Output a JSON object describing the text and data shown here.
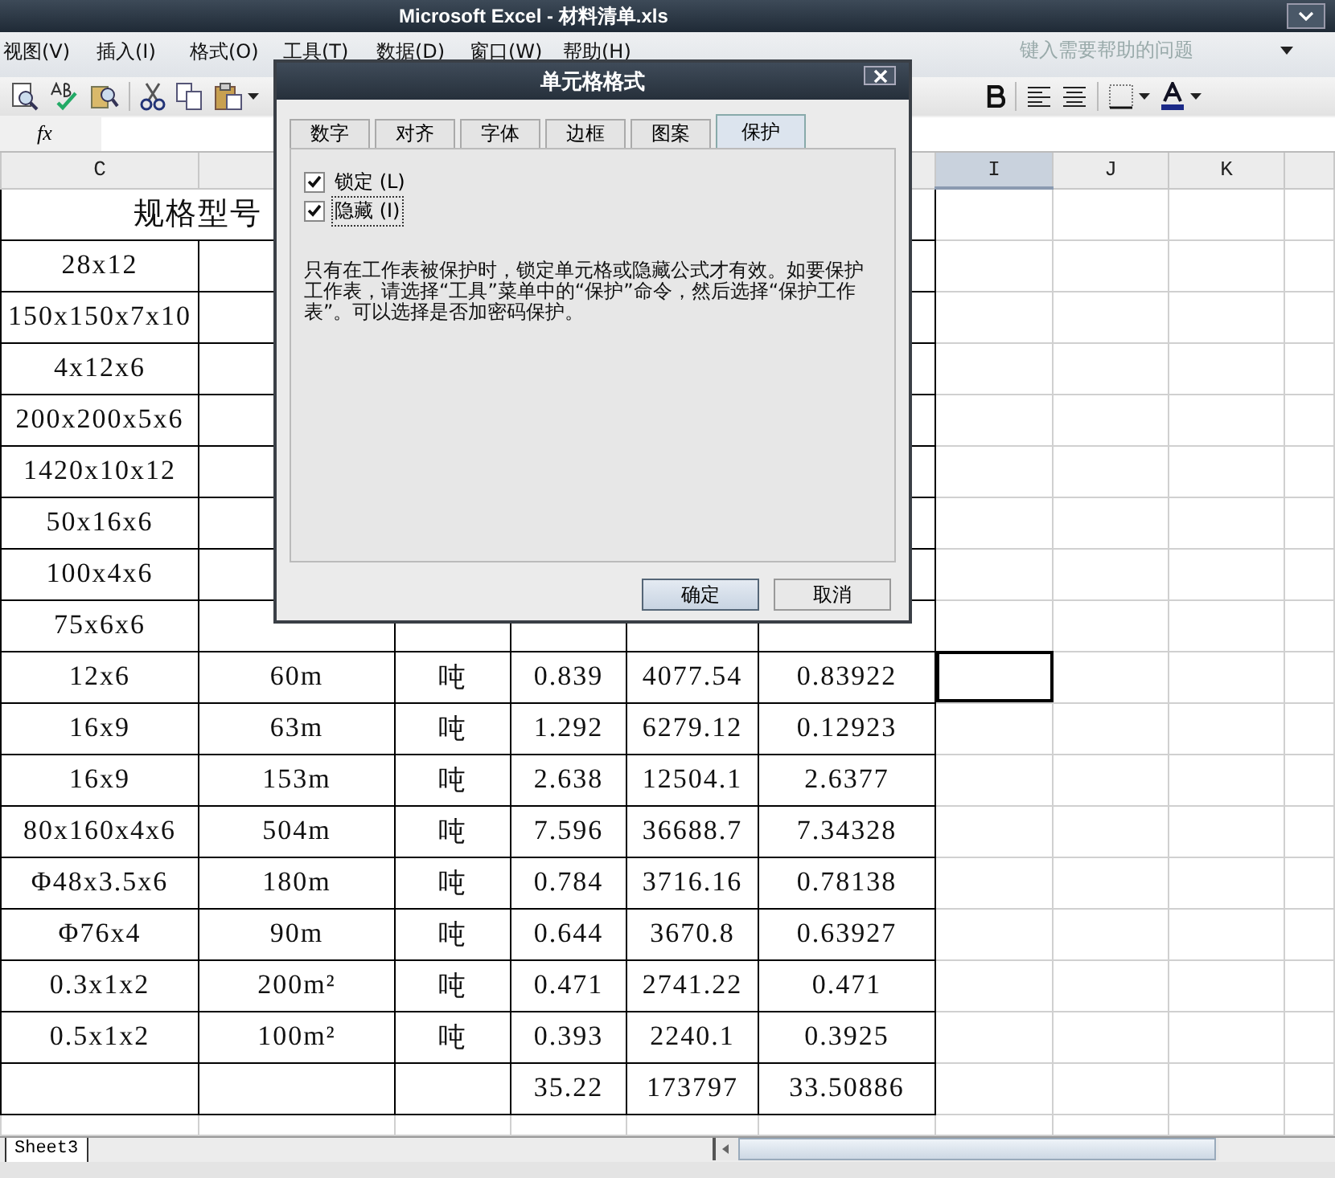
{
  "window": {
    "title": "Microsoft Excel - 材料清单.xls"
  },
  "menu": [
    "视图(V)",
    "插入(I)",
    "格式(O)",
    "工具(T)",
    "数据(D)",
    "窗口(W)",
    "帮助(H)"
  ],
  "help_search": {
    "placeholder": "键入需要帮助的问题"
  },
  "formula_bar": {
    "function_label": "fx"
  },
  "columns": [
    {
      "label": "C",
      "selected": false
    },
    {
      "label": "I",
      "selected": true
    },
    {
      "label": "J",
      "selected": false
    },
    {
      "label": "K",
      "selected": false
    }
  ],
  "header_row": "规格型号",
  "rows": [
    {
      "cells": [
        "28x12"
      ],
      "selected": false
    },
    {
      "cells": [
        "150x150x7x10"
      ],
      "selected": false
    },
    {
      "cells": [
        "4x12x6"
      ],
      "selected": false
    },
    {
      "cells": [
        "200x200x5x6"
      ],
      "selected": false
    },
    {
      "cells": [
        "1420x10x12"
      ],
      "selected": false
    },
    {
      "cells": [
        "50x16x6"
      ],
      "selected": false
    },
    {
      "cells": [
        "100x4x6"
      ],
      "selected": false
    },
    {
      "cells": [
        "75x6x6"
      ],
      "selected": false
    },
    {
      "cells": [
        "12x6",
        "60m",
        "吨",
        "0.839",
        "4077.54",
        "0.83922"
      ],
      "selected": true
    },
    {
      "cells": [
        "16x9",
        "63m",
        "吨",
        "1.292",
        "6279.12",
        "0.12923"
      ],
      "selected": false
    },
    {
      "cells": [
        "16x9",
        "153m",
        "吨",
        "2.638",
        "12504.1",
        "2.6377"
      ],
      "selected": false
    },
    {
      "cells": [
        "80x160x4x6",
        "504m",
        "吨",
        "7.596",
        "36688.7",
        "7.34328"
      ],
      "selected": false
    },
    {
      "cells": [
        "Φ48x3.5x6",
        "180m",
        "吨",
        "0.784",
        "3716.16",
        "0.78138"
      ],
      "selected": false
    },
    {
      "cells": [
        "Φ76x4",
        "90m",
        "吨",
        "0.644",
        "3670.8",
        "0.63927"
      ],
      "selected": false
    },
    {
      "cells": [
        "0.3x1x2",
        "200m²",
        "吨",
        "0.471",
        "2741.22",
        "0.471"
      ],
      "selected": false
    },
    {
      "cells": [
        "0.5x1x2",
        "100m²",
        "吨",
        "0.393",
        "2240.1",
        "0.3925"
      ],
      "selected": false
    },
    {
      "cells": [
        null,
        null,
        null,
        "35.22",
        "173797",
        "33.50886"
      ],
      "selected": false
    }
  ],
  "sheet_tab": "Sheet3",
  "dialog": {
    "title": "单元格格式",
    "tabs": [
      {
        "label": "数字",
        "selected": false
      },
      {
        "label": "对齐",
        "selected": false
      },
      {
        "label": "字体",
        "selected": false
      },
      {
        "label": "边框",
        "selected": false
      },
      {
        "label": "图案",
        "selected": false
      },
      {
        "label": "保护",
        "selected": true
      }
    ],
    "options": [
      {
        "label": "锁定 (L)",
        "checked": true,
        "focused": false
      },
      {
        "label": "隐藏 (I)",
        "checked": true,
        "focused": true
      }
    ],
    "note": "只有在工作表被保护时，锁定单元格或隐藏公式才有效。如要保护工作表，请选择“工具”菜单中的“保护”命令，然后选择“保护工作表”。可以选择是否加密码保护。",
    "buttons": [
      {
        "label": "确定",
        "default": true
      },
      {
        "label": "取消",
        "default": false
      }
    ]
  }
}
